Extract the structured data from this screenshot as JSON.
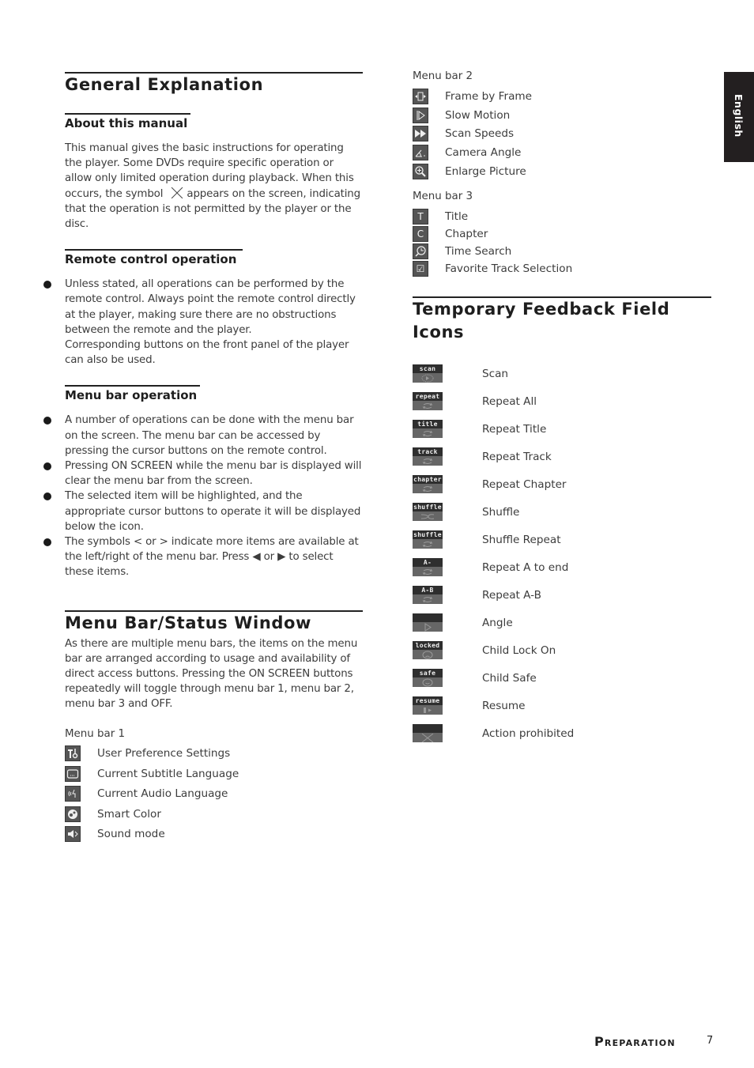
{
  "side_tab": {
    "label": "English"
  },
  "footer": {
    "section": "Preparation",
    "page_number": "7"
  },
  "general_explanation": {
    "title": "General Explanation",
    "about": {
      "heading": "About this manual",
      "text_before_symbol": "This manual gives the basic instructions for operating the player. Some DVDs require specific operation or allow only limited operation during playback. When this occurs, the symbol",
      "symbol_icon": "action-prohibited-x",
      "text_after_symbol": "appears on the screen, indicating that the operation is not permitted by the player or the disc."
    },
    "remote": {
      "heading": "Remote control operation",
      "bullets": [
        "Unless stated, all operations can be performed by the remote control. Always point the remote control directly at the player, making sure there are no obstructions between the remote and the player.\nCorresponding buttons on the front panel of the player can also be used."
      ]
    },
    "menu_bar_operation": {
      "heading": "Menu bar operation",
      "bullets": [
        "A number of operations can be done with the menu bar on the screen. The menu bar can be accessed by pressing the cursor buttons on the remote control.",
        "Pressing ON SCREEN while the menu bar is displayed will clear the menu bar from the screen.",
        "The selected item will be highlighted, and the appropriate cursor buttons to operate it will be displayed below the icon.",
        "The symbols < or > indicate more items are available at the left/right of the menu bar. Press ◀ or ▶ to select these items."
      ]
    }
  },
  "menu_bar_status": {
    "title": "Menu Bar/Status Window",
    "text": "As there are multiple menu bars, the items on the menu bar are arranged according to usage and availability of direct access buttons. Pressing the ON SCREEN buttons repeatedly will toggle through menu bar 1, menu bar 2, menu bar 3 and OFF.",
    "menu_bar_1": {
      "label": "Menu bar 1",
      "items": [
        {
          "icon": "user-preference-icon",
          "label": "User Preference Settings"
        },
        {
          "icon": "subtitle-icon",
          "label": "Current Subtitle Language"
        },
        {
          "icon": "audio-language-icon",
          "label": "Current Audio Language"
        },
        {
          "icon": "smart-color-icon",
          "label": "Smart Color"
        },
        {
          "icon": "sound-mode-icon",
          "label": "Sound mode"
        }
      ]
    },
    "menu_bar_2": {
      "label": "Menu bar 2",
      "items": [
        {
          "icon": "frame-by-frame-icon",
          "label": "Frame by Frame"
        },
        {
          "icon": "slow-motion-icon",
          "label": "Slow Motion"
        },
        {
          "icon": "scan-speeds-icon",
          "label": "Scan Speeds"
        },
        {
          "icon": "camera-angle-icon",
          "label": "Camera Angle"
        },
        {
          "icon": "enlarge-picture-icon",
          "label": "Enlarge Picture"
        }
      ]
    },
    "menu_bar_3": {
      "label": "Menu bar 3",
      "items": [
        {
          "icon": "title-icon",
          "glyph": "T",
          "label": "Title"
        },
        {
          "icon": "chapter-icon",
          "glyph": "C",
          "label": "Chapter"
        },
        {
          "icon": "time-search-icon",
          "label": "Time Search"
        },
        {
          "icon": "favorite-track-icon",
          "glyph": "☑",
          "label": "Favorite Track Selection"
        }
      ]
    }
  },
  "feedback_icons": {
    "title": "Temporary Feedback Field Icons",
    "items": [
      {
        "badge": "scan",
        "symbol": "play-circle",
        "label": "Scan"
      },
      {
        "badge": "repeat",
        "symbol": "repeat",
        "label": "Repeat All"
      },
      {
        "badge": "title",
        "symbol": "repeat",
        "label": "Repeat Title"
      },
      {
        "badge": "track",
        "symbol": "repeat",
        "label": "Repeat Track"
      },
      {
        "badge": "chapter",
        "symbol": "repeat",
        "label": "Repeat Chapter"
      },
      {
        "badge": "shuffle",
        "symbol": "shuffle",
        "label": "Shuffle"
      },
      {
        "badge": "shuffle",
        "symbol": "repeat",
        "label": "Shuffle Repeat"
      },
      {
        "badge": "A-",
        "symbol": "repeat",
        "label": "Repeat A to end"
      },
      {
        "badge": "A-B",
        "symbol": "repeat",
        "label": "Repeat A-B"
      },
      {
        "badge": "",
        "symbol": "angle",
        "label": "Angle"
      },
      {
        "badge": "locked",
        "symbol": "sad-face",
        "label": "Child Lock On"
      },
      {
        "badge": "safe",
        "symbol": "smile-face",
        "label": "Child Safe"
      },
      {
        "badge": "resume",
        "symbol": "resume",
        "label": "Resume"
      },
      {
        "badge": "",
        "symbol": "cross",
        "label": "Action prohibited"
      }
    ]
  }
}
